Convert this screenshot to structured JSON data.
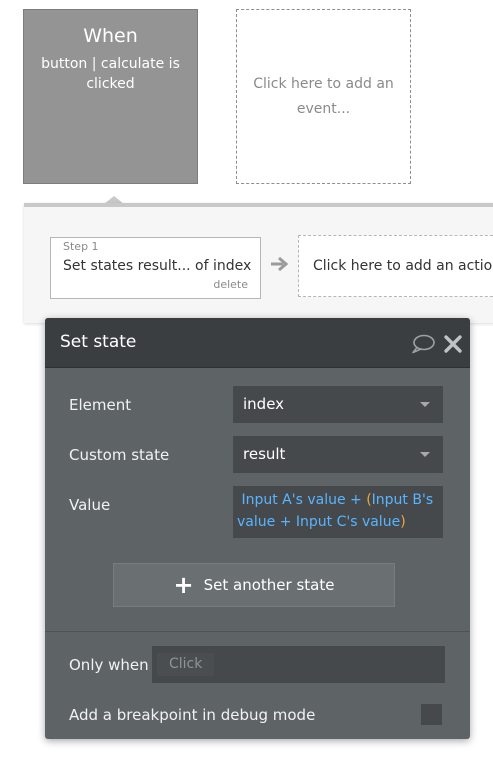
{
  "events": {
    "selected": {
      "title": "When",
      "subtitle": "button | calculate is clicked"
    },
    "add_placeholder": "Click here to add an event..."
  },
  "step_strip": {
    "step": {
      "label": "Step 1",
      "name": "Set states result... of index",
      "delete_label": "delete"
    },
    "add_action_placeholder": "Click here to add an action"
  },
  "panel": {
    "title": "Set state",
    "fields": {
      "element": {
        "label": "Element",
        "value": "index"
      },
      "custom_state": {
        "label": "Custom state",
        "value": "result"
      },
      "value": {
        "label": "Value",
        "expr_part1": "Input A's value + ",
        "open_paren": "(",
        "expr_part2": "Input B's value + Input C's value",
        "close_paren": ")"
      }
    },
    "add_state_button": "Set another state",
    "only_when": {
      "label": "Only when",
      "placeholder": "Click"
    },
    "breakpoint": {
      "label": "Add a breakpoint in debug mode",
      "checked": false
    }
  },
  "colors": {
    "selected_event_bg": "#949494",
    "panel_bg": "#5e6366",
    "panel_header_bg": "#3a3e40",
    "expression_blue": "#5ab4ff",
    "expression_paren": "#f0a63a"
  },
  "icons": [
    "arrow-right-icon",
    "comment-icon",
    "close-icon",
    "plus-icon"
  ]
}
